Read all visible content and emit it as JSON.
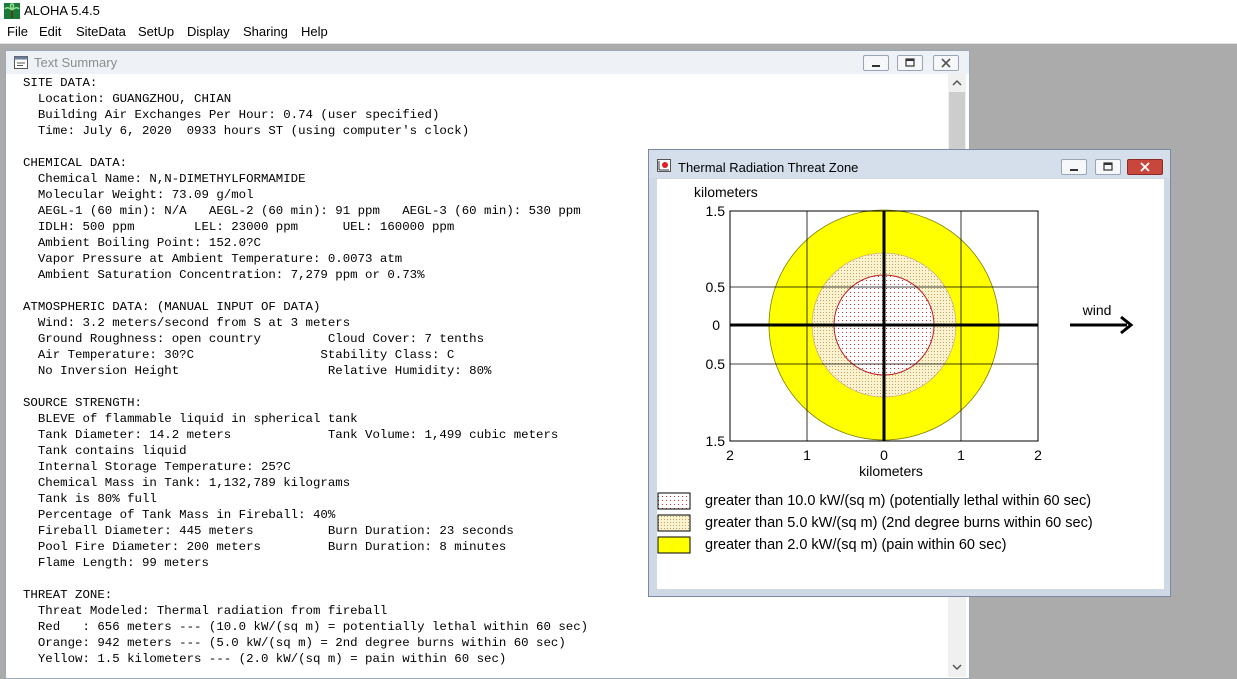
{
  "app": {
    "title": "ALOHA 5.4.5",
    "icon": "aloha-palm-icon"
  },
  "menu": [
    "File",
    "Edit",
    "SiteData",
    "SetUp",
    "Display",
    "Sharing",
    "Help"
  ],
  "text_summary": {
    "title": "Text Summary",
    "lines": [
      "SITE DATA:",
      "  Location: GUANGZHOU, CHIAN",
      "  Building Air Exchanges Per Hour: 0.74 (user specified)",
      "  Time: July 6, 2020  0933 hours ST (using computer's clock)",
      "",
      "CHEMICAL DATA:",
      "  Chemical Name: N,N-DIMETHYLFORMAMIDE",
      "  Molecular Weight: 73.09 g/mol",
      "  AEGL-1 (60 min): N/A   AEGL-2 (60 min): 91 ppm   AEGL-3 (60 min): 530 ppm",
      "  IDLH: 500 ppm        LEL: 23000 ppm      UEL: 160000 ppm",
      "  Ambient Boiling Point: 152.0?C",
      "  Vapor Pressure at Ambient Temperature: 0.0073 atm",
      "  Ambient Saturation Concentration: 7,279 ppm or 0.73%",
      "",
      "ATMOSPHERIC DATA: (MANUAL INPUT OF DATA)",
      "  Wind: 3.2 meters/second from S at 3 meters",
      "  Ground Roughness: open country         Cloud Cover: 7 tenths",
      "  Air Temperature: 30?C                 Stability Class: C",
      "  No Inversion Height                    Relative Humidity: 80%",
      "",
      "SOURCE STRENGTH:",
      "  BLEVE of flammable liquid in spherical tank",
      "  Tank Diameter: 14.2 meters             Tank Volume: 1,499 cubic meters",
      "  Tank contains liquid",
      "  Internal Storage Temperature: 25?C",
      "  Chemical Mass in Tank: 1,132,789 kilograms",
      "  Tank is 80% full",
      "  Percentage of Tank Mass in Fireball: 40%",
      "  Fireball Diameter: 445 meters          Burn Duration: 23 seconds",
      "  Pool Fire Diameter: 200 meters         Burn Duration: 8 minutes",
      "  Flame Length: 99 meters",
      "",
      "THREAT ZONE:",
      "  Threat Modeled: Thermal radiation from fireball",
      "  Red   : 656 meters --- (10.0 kW/(sq m) = potentially lethal within 60 sec)",
      "  Orange: 942 meters --- (5.0 kW/(sq m) = 2nd degree burns within 60 sec)",
      "  Yellow: 1.5 kilometers --- (2.0 kW/(sq m) = pain within 60 sec)"
    ]
  },
  "threat_zone": {
    "title": "Thermal Radiation Threat Zone",
    "y_unit": "kilometers",
    "x_unit": "kilometers",
    "y_ticks": [
      "1.5",
      "0.5",
      "0",
      "0.5",
      "1.5"
    ],
    "x_ticks": [
      "2",
      "1",
      "0",
      "1",
      "2"
    ],
    "wind_label": "wind",
    "zones": [
      {
        "radius_km": 1.5,
        "color": "#ffff00",
        "pattern": "solid"
      },
      {
        "radius_km": 0.942,
        "color": "#e8dcb0",
        "pattern": "dotted-orange"
      },
      {
        "radius_km": 0.656,
        "color": "#ffffff",
        "pattern": "dotted-red"
      }
    ],
    "legend": [
      {
        "label": "greater than 10.0 kW/(sq m) (potentially lethal within 60 sec)",
        "swatch": "dotted-red"
      },
      {
        "label": "greater than 5.0 kW/(sq m) (2nd degree burns within 60 sec)",
        "swatch": "dotted-orange"
      },
      {
        "label": "greater than 2.0 kW/(sq m) (pain within 60 sec)",
        "swatch": "solid-yellow"
      }
    ]
  }
}
